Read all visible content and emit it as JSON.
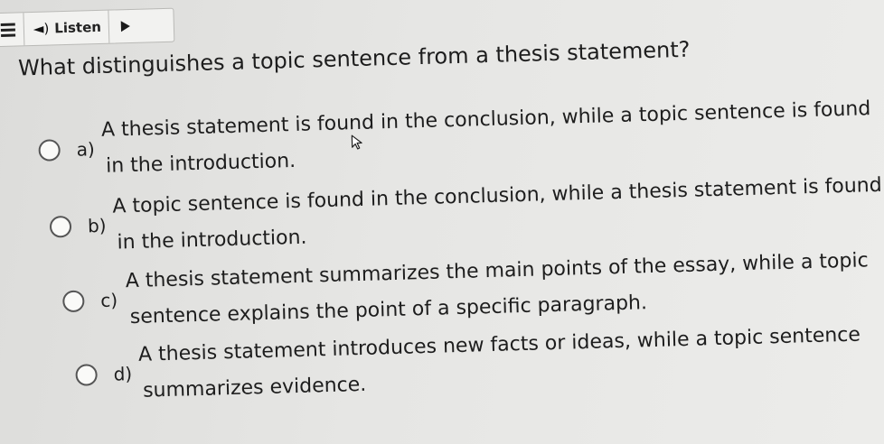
{
  "toolbar": {
    "menu_icon": "hamburger-menu-icon",
    "speaker_icon": "speaker-icon",
    "listen_label": "Listen",
    "play_icon": "play-icon"
  },
  "question": {
    "text": "What distinguishes a topic sentence from a thesis statement?"
  },
  "options": [
    {
      "letter": "a)",
      "line1": "A thesis statement is found in the conclusion, while a topic sentence is found",
      "line2": "in the introduction."
    },
    {
      "letter": "b)",
      "line1": "A topic sentence is found in the conclusion, while a thesis statement is found",
      "line2": "in the introduction."
    },
    {
      "letter": "c)",
      "line1": "A thesis statement summarizes the main points of the essay, while a topic",
      "line2": "sentence explains the point of a specific paragraph."
    },
    {
      "letter": "d)",
      "line1": "A thesis statement introduces new facts or ideas, while a topic sentence",
      "line2": "summarizes evidence."
    }
  ]
}
